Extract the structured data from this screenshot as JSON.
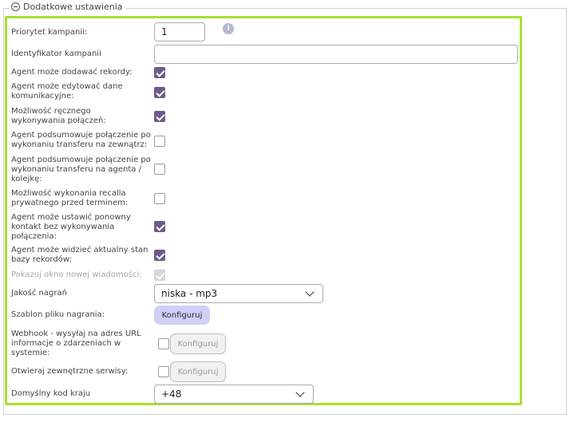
{
  "legend": "Dodatkowe ustawienia",
  "fields": {
    "priorytet": {
      "label": "Priorytet kampanii:",
      "value": "1"
    },
    "identyfikator": {
      "label": "Identyfikator kampanii",
      "value": ""
    },
    "dodawac": {
      "label": "Agent może dodawać rekordy:",
      "checked": true
    },
    "edytowac": {
      "label": "Agent może edytować dane komunikacyjne:",
      "checked": true
    },
    "reczne": {
      "label": "Możliwość ręcznego wykonywania połączeń:",
      "checked": true
    },
    "transfer_zew": {
      "label": "Agent podsumowuje połączenie po wykonaniu transferu na zewnątrz:",
      "checked": false
    },
    "transfer_agent": {
      "label": "Agent podsumowuje połączenie po wykonaniu transferu na agenta / kolejkę:",
      "checked": false
    },
    "recall": {
      "label": "Możliwość wykonania recalla prywatnego przed terminem:",
      "checked": false
    },
    "ponowny": {
      "label": "Agent może ustawić ponowny kontakt bez wykonywania połączenia:",
      "checked": true
    },
    "stan_bazy": {
      "label": "Agent może widzieć aktualny stan bazy rekordów:",
      "checked": true
    },
    "okno": {
      "label": "Pokazuj okno nowej wiadomości:",
      "checked": true,
      "disabled": true
    },
    "jakosc": {
      "label": "Jakość nagrań",
      "value": "niska - mp3"
    },
    "szablon": {
      "label": "Szablon pliku nagrania:",
      "button": "Konfiguruj"
    },
    "webhook": {
      "label": "Webhook - wysyłaj na adres URL informacje o zdarzeniach w systemie:",
      "button": "Konfiguruj",
      "checked": false
    },
    "serwisy": {
      "label": "Otwieraj zewnętrzne serwisy:",
      "button": "Konfiguruj",
      "checked": false
    },
    "kod_kraju": {
      "label": "Domyślny kod kraju",
      "value": "+48"
    }
  },
  "info_icon_glyph": "i",
  "colors": {
    "accent_border": "#a8df2e",
    "checkbox_checked": "#6f5b8a",
    "button_primary": "#cfd0f5"
  }
}
